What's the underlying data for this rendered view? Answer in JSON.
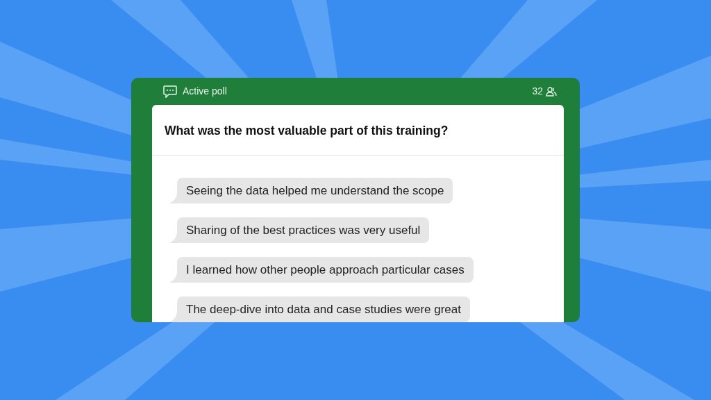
{
  "poll": {
    "label": "Active poll",
    "participants": "32"
  },
  "question": "What was the most valuable part of this training?",
  "answers": [
    {
      "text": "Seeing the data helped me understand the scope"
    },
    {
      "text": "Sharing of the best practices was very useful"
    },
    {
      "text": "I learned how other people approach particular cases"
    },
    {
      "text": "The deep-dive into data and case studies were great"
    }
  ]
}
